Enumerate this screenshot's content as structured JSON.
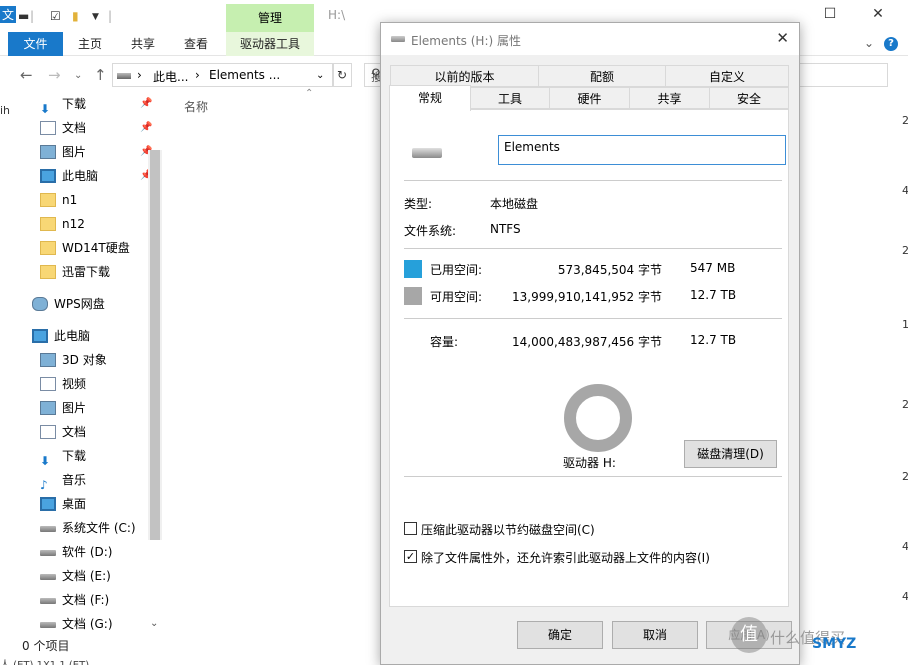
{
  "explorer": {
    "title_text": "H:\\",
    "ribbon_context_header": "管理",
    "ribbon_tabs": [
      "文件",
      "主页",
      "共享",
      "查看",
      "驱动器工具"
    ],
    "address": [
      "此电...",
      "Elements ..."
    ],
    "search_placeholder": "搜",
    "column_name": "名称",
    "status": "0 个项目",
    "left_edge": [
      "文",
      "ih"
    ],
    "right_edge": [
      "2",
      "4",
      "2",
      "1",
      "2",
      "2",
      "4",
      "4"
    ],
    "bottom_text": "人 (ET)   1X1   1 (ET)",
    "sidebar": [
      {
        "label": "下载",
        "icon": "download-icon",
        "pinned": true
      },
      {
        "label": "文档",
        "icon": "document-icon",
        "pinned": true
      },
      {
        "label": "图片",
        "icon": "picture-icon",
        "pinned": true
      },
      {
        "label": "此电脑",
        "icon": "computer-icon",
        "pinned": true
      },
      {
        "label": "n1",
        "icon": "folder-icon"
      },
      {
        "label": "n12",
        "icon": "folder-icon"
      },
      {
        "label": "WD14T硬盘",
        "icon": "folder-icon"
      },
      {
        "label": "迅雷下载",
        "icon": "folder-icon"
      },
      {
        "label": "WPS网盘",
        "icon": "cloud-icon"
      },
      {
        "label": "此电脑",
        "icon": "computer-icon"
      },
      {
        "label": "3D 对象",
        "icon": "cube-icon"
      },
      {
        "label": "视频",
        "icon": "video-icon"
      },
      {
        "label": "图片",
        "icon": "picture-icon"
      },
      {
        "label": "文档",
        "icon": "document-icon"
      },
      {
        "label": "下载",
        "icon": "download-icon"
      },
      {
        "label": "音乐",
        "icon": "music-icon"
      },
      {
        "label": "桌面",
        "icon": "desktop-icon"
      },
      {
        "label": "系统文件 (C:)",
        "icon": "system-drive-icon"
      },
      {
        "label": "软件 (D:)",
        "icon": "drive-icon"
      },
      {
        "label": "文档 (E:)",
        "icon": "drive-icon"
      },
      {
        "label": "文档 (F:)",
        "icon": "drive-icon"
      },
      {
        "label": "文档 (G:)",
        "icon": "drive-icon"
      }
    ]
  },
  "dialog": {
    "title": "Elements (H:) 属性",
    "tabs_row1": [
      "以前的版本",
      "配额",
      "自定义"
    ],
    "tabs_row2": [
      "常规",
      "工具",
      "硬件",
      "共享",
      "安全"
    ],
    "active_tab": "常规",
    "name_value": "Elements",
    "type_label": "类型:",
    "type_value": "本地磁盘",
    "fs_label": "文件系统:",
    "fs_value": "NTFS",
    "used_label": "已用空间:",
    "used_bytes": "573,845,504 字节",
    "used_size": "547 MB",
    "free_label": "可用空间:",
    "free_bytes": "13,999,910,141,952 字节",
    "free_size": "12.7 TB",
    "cap_label": "容量:",
    "cap_bytes": "14,000,483,987,456 字节",
    "cap_size": "12.7 TB",
    "used_fraction": 4e-05,
    "drive_label": "驱动器 H:",
    "cleanup_button": "磁盘清理(D)",
    "compress_label": "压缩此驱动器以节约磁盘空间(C)",
    "compress_checked": false,
    "index_label": "除了文件属性外，还允许索引此驱动器上文件的内容(I)",
    "index_checked": true,
    "ok_button": "确定",
    "cancel_button": "取消",
    "apply_button": "应用(A)",
    "colors": {
      "used": "#26a0da",
      "free": "#a7a7a7"
    }
  },
  "watermark": {
    "text": "什么值得买",
    "brand": "SMYZ"
  }
}
